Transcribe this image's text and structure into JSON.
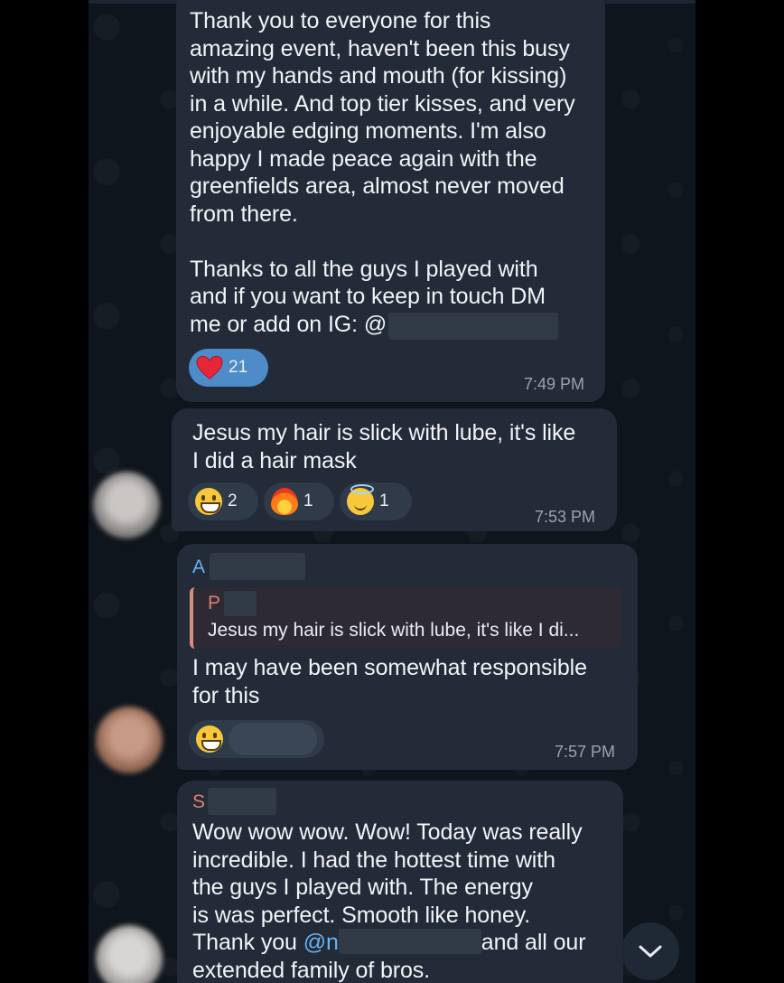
{
  "messages": [
    {
      "id": "m1",
      "text": "Thank you to everyone for this\namazing event, haven't been this busy\nwith my hands and mouth (for kissing)\nin a while. And top tier kisses, and very\nenjoyable edging moments. I'm also\nhappy I made peace again with the\ngreenfields area, almost never moved\nfrom there.\n\nThanks to all the guys I played with\nand if you want to keep in touch DM\nme or add on IG: @",
      "time": "7:49 PM",
      "reactions": [
        {
          "emoji": "red-heart",
          "count": "21",
          "mine": true
        }
      ]
    },
    {
      "id": "m2",
      "text": "Jesus my hair is slick with lube, it's like\nI did a hair mask",
      "time": "7:53 PM",
      "reactions": [
        {
          "emoji": "grinning-face",
          "count": "2"
        },
        {
          "emoji": "fire",
          "count": "1"
        },
        {
          "emoji": "smiling-face-with-halo",
          "count": "1"
        }
      ]
    },
    {
      "id": "m3",
      "sender_initial": "A",
      "reply": {
        "sender_initial": "P",
        "text": "Jesus my hair is slick with lube, it's like I di..."
      },
      "text": "I may have been somewhat responsible\nfor this",
      "time": "7:57 PM",
      "reactions": [
        {
          "emoji": "grinning-face",
          "count": ""
        }
      ]
    },
    {
      "id": "m4",
      "sender_initial": "S",
      "text_line1": "Wow wow wow. Wow! Today was really\nincredible. I had the hottest time with\nthe guys I played with. The energy\nis was perfect. Smooth like honey.",
      "text_mention_prefix": "Thank you ",
      "text_mention": "@n",
      "text_after_mention": "and all our",
      "text_last": "extended family of bros."
    }
  ],
  "colors": {
    "sender_a": "#6ab3f3",
    "sender_s": "#e07e74",
    "reply_sender": "#e07e74",
    "bubble": "#222b37",
    "background": "#0f151c"
  },
  "scroll_button": {
    "icon": "chevron-down-icon"
  }
}
